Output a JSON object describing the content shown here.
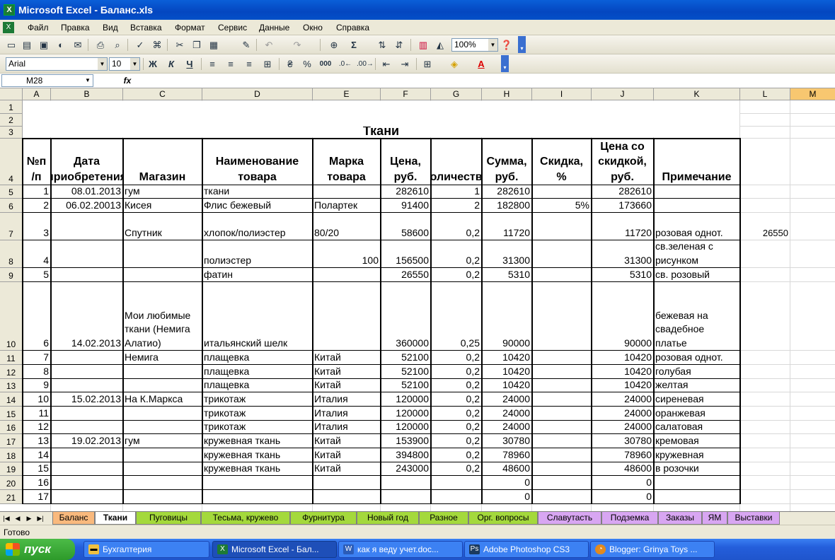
{
  "window": {
    "title": "Microsoft Excel - Баланс.xls"
  },
  "menu": [
    "Файл",
    "Правка",
    "Вид",
    "Вставка",
    "Формат",
    "Сервис",
    "Данные",
    "Окно",
    "Справка"
  ],
  "toolbar": {
    "zoom": "100%",
    "sigma": "Σ",
    "font": "Arial",
    "size": "10",
    "bold": "Ж",
    "italic": "К",
    "underline": "Ч",
    "percent": "%",
    "thousands": "000"
  },
  "formula": {
    "namebox": "M28",
    "fx": "fx",
    "content": ""
  },
  "columns": [
    "A",
    "B",
    "C",
    "D",
    "E",
    "F",
    "G",
    "H",
    "I",
    "J",
    "K",
    "L",
    "M"
  ],
  "rows": [
    "1",
    "2",
    "3",
    "4",
    "5",
    "6",
    "7",
    "8",
    "9",
    "10",
    "11",
    "12",
    "13",
    "14",
    "15",
    "16",
    "17",
    "18",
    "19",
    "20",
    "21"
  ],
  "title": "Ткани",
  "headers": [
    "№п /п",
    "Дата приобретения",
    "Магазин",
    "Наименование товара",
    "Марка товара",
    "Цена, руб.",
    "Количество",
    "Сумма, руб.",
    "Скидка, %",
    "Цена со скидкой, руб.",
    "Примечание"
  ],
  "table": [
    [
      "1",
      "08.01.2013",
      "гум",
      "ткани",
      "",
      "282610",
      "1",
      "282610",
      "",
      "282610",
      ""
    ],
    [
      "2",
      "06.02.20013",
      "Кисея",
      "Флис бежевый",
      "Полартек",
      "91400",
      "2",
      "182800",
      "5%",
      "173660",
      ""
    ],
    [
      "3",
      "",
      "Спутник",
      "хлопок/полиэстер",
      "80/20",
      "58600",
      "0,2",
      "11720",
      "",
      "11720",
      "розовая однот."
    ],
    [
      "4",
      "",
      "",
      "полиэстер",
      "100",
      "156500",
      "0,2",
      "31300",
      "",
      "31300",
      "св.зеленая с\nрисунком"
    ],
    [
      "5",
      "",
      "",
      "фатин",
      "",
      "26550",
      "0,2",
      "5310",
      "",
      "5310",
      "св. розовый"
    ],
    [
      "6",
      "14.02.2013",
      "Мои\nлюбимые\nткани\n(Немига\nАлатио)",
      "итальянский шелк",
      "",
      "360000",
      "0,25",
      "90000",
      "",
      "90000",
      "бежевая на\nсвадебное\nплатье"
    ],
    [
      "7",
      "",
      "Немига",
      "плащевка",
      "Китай",
      "52100",
      "0,2",
      "10420",
      "",
      "10420",
      "розовая однот."
    ],
    [
      "8",
      "",
      "",
      "плащевка",
      "Китай",
      "52100",
      "0,2",
      "10420",
      "",
      "10420",
      "голубая"
    ],
    [
      "9",
      "",
      "",
      "плащевка",
      "Китай",
      "52100",
      "0,2",
      "10420",
      "",
      "10420",
      "желтая"
    ],
    [
      "10",
      "15.02.2013",
      "На К.Маркса",
      "трикотаж",
      "Италия",
      "120000",
      "0,2",
      "24000",
      "",
      "24000",
      "сиреневая"
    ],
    [
      "11",
      "",
      "",
      "трикотаж",
      "Италия",
      "120000",
      "0,2",
      "24000",
      "",
      "24000",
      "оранжевая"
    ],
    [
      "12",
      "",
      "",
      "трикотаж",
      "Италия",
      "120000",
      "0,2",
      "24000",
      "",
      "24000",
      "салатовая"
    ],
    [
      "13",
      "19.02.2013",
      "гум",
      "кружевная ткань",
      "Китай",
      "153900",
      "0,2",
      "30780",
      "",
      "30780",
      "кремовая"
    ],
    [
      "14",
      "",
      "",
      "кружевная ткань",
      "Китай",
      "394800",
      "0,2",
      "78960",
      "",
      "78960",
      "кружевная"
    ],
    [
      "15",
      "",
      "",
      "кружевная ткань",
      "Китай",
      "243000",
      "0,2",
      "48600",
      "",
      "48600",
      "в розочки"
    ],
    [
      "16",
      "",
      "",
      "",
      "",
      "",
      "",
      "0",
      "",
      "0",
      ""
    ],
    [
      "17",
      "",
      "",
      "",
      "",
      "",
      "",
      "0",
      "",
      "0",
      ""
    ]
  ],
  "extra": {
    "L7": "26550"
  },
  "sheet_tabs": [
    {
      "label": "Баланс",
      "color": "#f9b97d"
    },
    {
      "label": "Ткани",
      "color": "#ffffff"
    },
    {
      "label": "Пуговицы",
      "color": "#a4d93c"
    },
    {
      "label": "Тесьма, кружево",
      "color": "#a4d93c"
    },
    {
      "label": "Фурнитура",
      "color": "#a4d93c"
    },
    {
      "label": "Новый год",
      "color": "#a4d93c"
    },
    {
      "label": "Разное",
      "color": "#a4d93c"
    },
    {
      "label": "Орг. вопросы",
      "color": "#a4d93c"
    },
    {
      "label": "Славутасть",
      "color": "#d8a6f2"
    },
    {
      "label": "Подземка",
      "color": "#d8a6f2"
    },
    {
      "label": "Заказы",
      "color": "#d8a6f2"
    },
    {
      "label": "ЯМ",
      "color": "#d8a6f2"
    },
    {
      "label": "Выставки",
      "color": "#d8a6f2"
    }
  ],
  "status": "Готово",
  "taskbar": {
    "start": "пуск",
    "items": [
      "Бухгалтерия",
      "Microsoft Excel - Бал...",
      "как я веду учет.doc...",
      "Adobe Photoshop CS3",
      "Blogger: Grinya Toys ..."
    ]
  }
}
